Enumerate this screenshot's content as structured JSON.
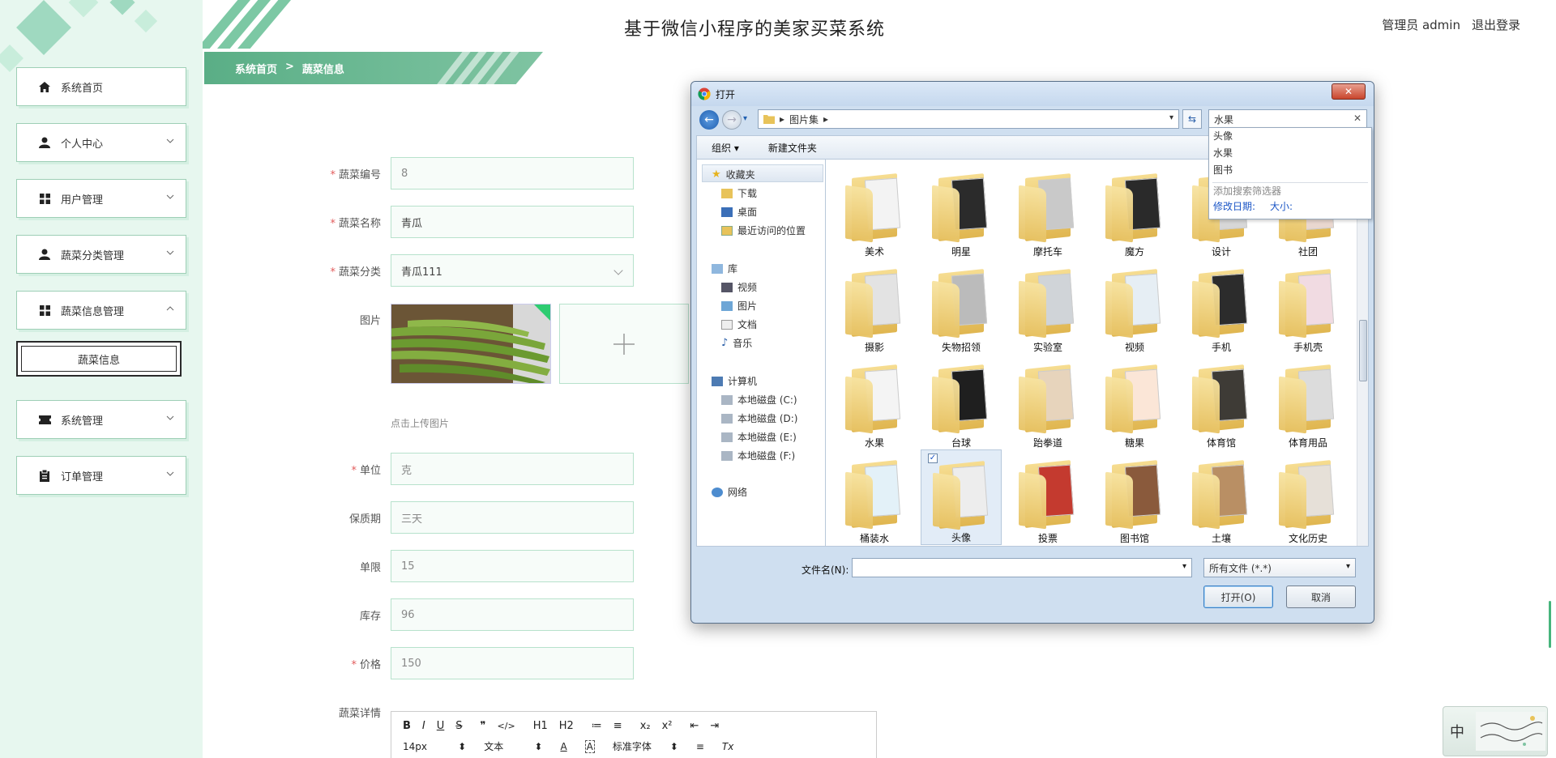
{
  "app": {
    "title": "基于微信小程序的美家买菜系统",
    "user_label": "管理员 admin",
    "logout_label": "退出登录"
  },
  "breadcrumb": {
    "home": "系统首页",
    "separator": ">",
    "current": "蔬菜信息"
  },
  "sidebar": {
    "items": [
      {
        "label": "系统首页",
        "icon": "home-icon"
      },
      {
        "label": "个人中心",
        "icon": "person-icon"
      },
      {
        "label": "用户管理",
        "icon": "grid-icon"
      },
      {
        "label": "蔬菜分类管理",
        "icon": "person-icon"
      },
      {
        "label": "蔬菜信息管理",
        "icon": "grid-icon"
      },
      {
        "label": "系统管理",
        "icon": "ticket-icon"
      },
      {
        "label": "订单管理",
        "icon": "clipboard-icon"
      }
    ],
    "subitem": {
      "label": "蔬菜信息"
    }
  },
  "form": {
    "id_label": "蔬菜编号",
    "id_value": "8",
    "name_label": "蔬菜名称",
    "name_value": "青瓜",
    "category_label": "蔬菜分类",
    "category_value": "青瓜111",
    "image_label": "图片",
    "upload_hint": "点击上传图片",
    "unit_label": "单位",
    "unit_value": "克",
    "shelf_label": "保质期",
    "shelf_value": "三天",
    "limit_label": "单限",
    "limit_value": "15",
    "stock_label": "库存",
    "stock_value": "96",
    "price_label": "价格",
    "price_value": "150",
    "detail_label": "蔬菜详情"
  },
  "editor": {
    "row1": [
      "B",
      "I",
      "U",
      "S",
      "❞",
      "</>",
      "H1",
      "H2",
      "≔",
      "≡",
      "x₂",
      "x²",
      "⇤",
      "⇥"
    ],
    "font_size": "14px",
    "font_size_caret": "⬍",
    "text_type": "文本",
    "text_type_caret": "⬍",
    "font_family": "标准字体",
    "font_family_caret": "⬍",
    "glyph_color": "A",
    "glyph_bg": "A",
    "glyph_align": "≡",
    "glyph_clear": "Tx"
  },
  "dialog": {
    "title": "打开",
    "close_label": "✕",
    "address": [
      "图片集"
    ],
    "search_value": "水果",
    "search_suggestions": [
      "头像",
      "水果",
      "图书"
    ],
    "search_filter_note": "添加搜索筛选器",
    "search_filter_date": "修改日期:",
    "search_filter_size": "大小:",
    "toolbar_organize": "组织 ▾",
    "toolbar_new_folder": "新建文件夹",
    "nav": {
      "favorites": "收藏夹",
      "fav_items": [
        "下载",
        "桌面",
        "最近访问的位置"
      ],
      "library": "库",
      "lib_items": [
        "视频",
        "图片",
        "文档",
        "音乐"
      ],
      "computer": "计算机",
      "drives": [
        "本地磁盘 (C:)",
        "本地磁盘 (D:)",
        "本地磁盘 (E:)",
        "本地磁盘 (F:)"
      ],
      "network": "网络"
    },
    "folders": [
      "美术",
      "明星",
      "摩托车",
      "魔方",
      "设计",
      "社团",
      "摄影",
      "失物招领",
      "实验室",
      "视频",
      "手机",
      "手机壳",
      "水果",
      "台球",
      "跆拳道",
      "糖果",
      "体育馆",
      "体育用品",
      "桶装水",
      "头像",
      "投票",
      "图书馆",
      "土壤",
      "文化历史"
    ],
    "selected_folder": "头像",
    "filename_label": "文件名(N):",
    "filename_value": "",
    "filetype_value": "所有文件 (*.*)",
    "open_button": "打开(O)",
    "cancel_button": "取消"
  },
  "ime": {
    "char": "中"
  },
  "colors": {
    "accent": "#5aae86",
    "sidebar_bg": "#e7f7ef",
    "required": "#e25c5c"
  }
}
